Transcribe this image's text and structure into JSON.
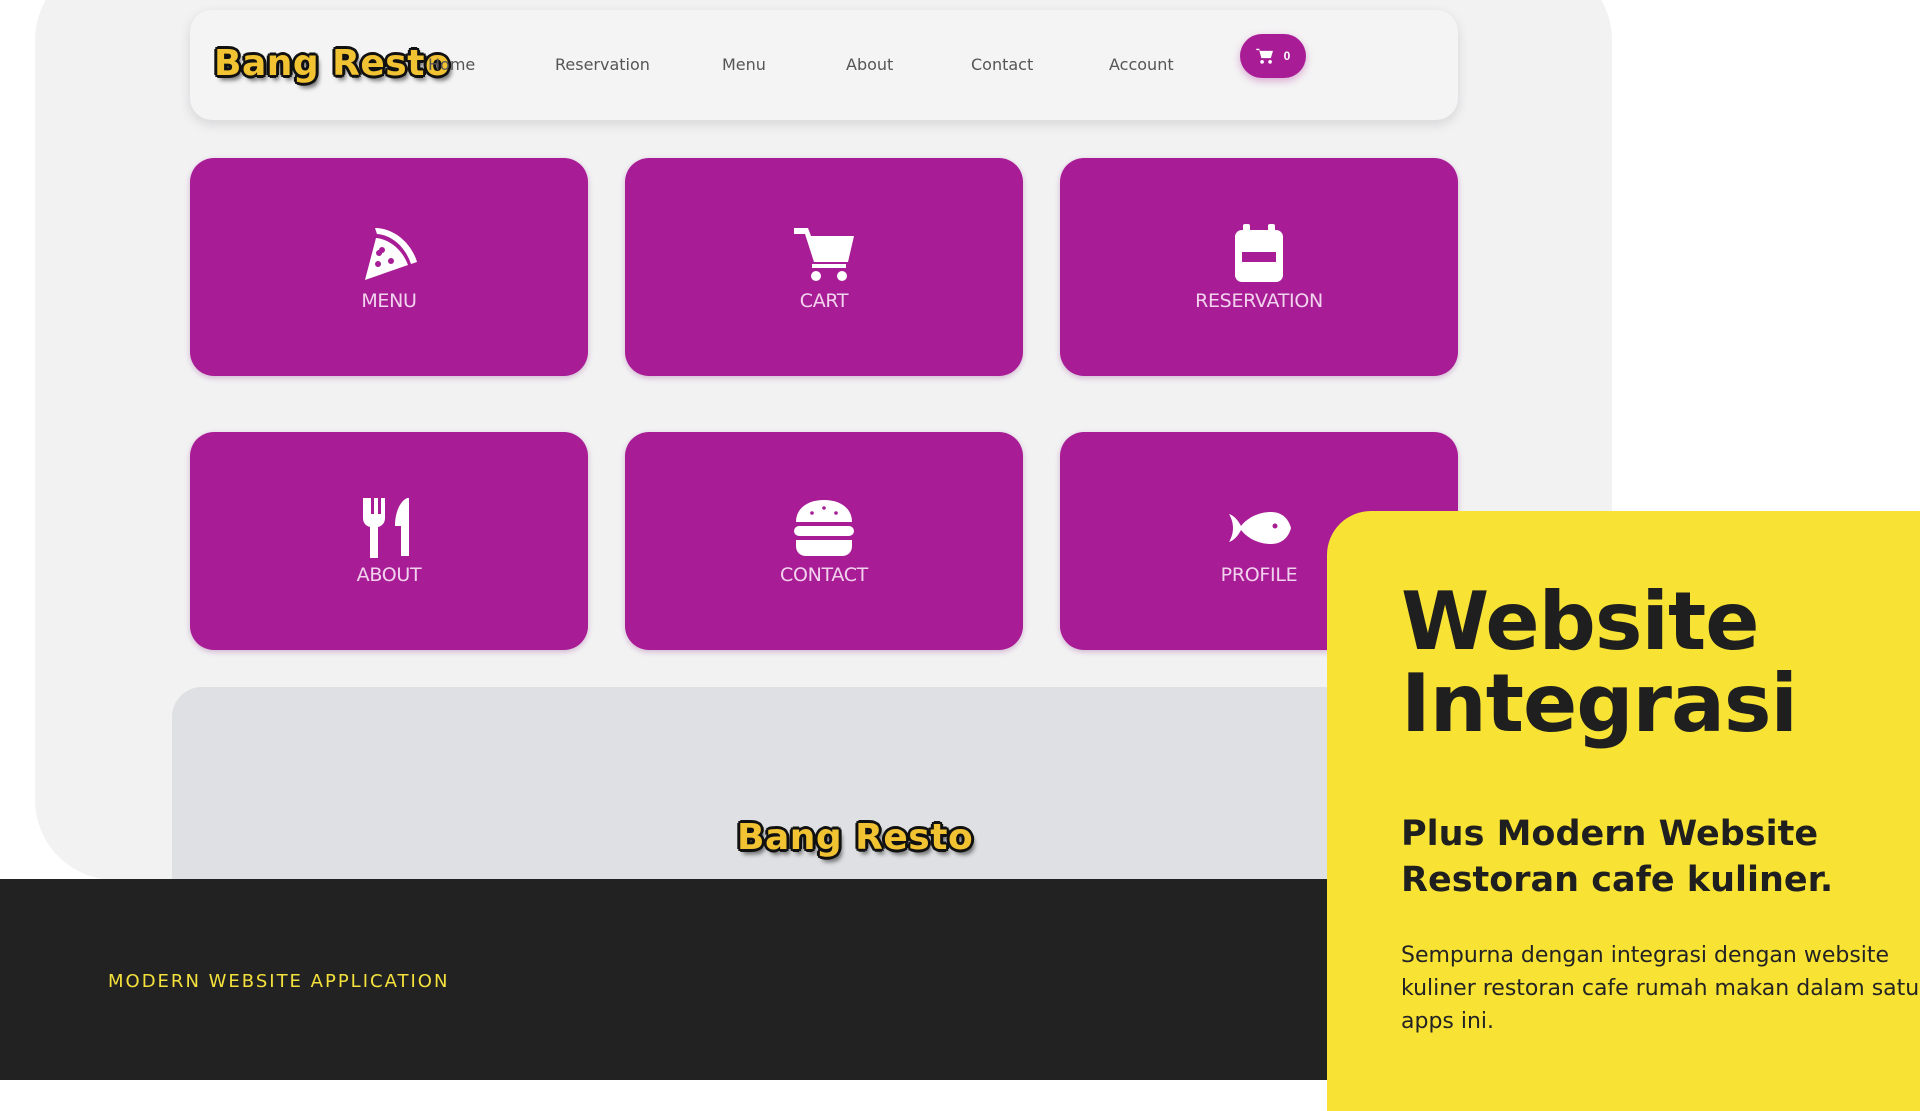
{
  "mockup": {
    "brand": "Bang Resto",
    "nav": {
      "links": [
        "Home",
        "Reservation",
        "Menu",
        "About",
        "Contact",
        "Account"
      ],
      "cart_count": "0"
    },
    "tiles": [
      {
        "label": "MENU",
        "icon": "pizza-icon"
      },
      {
        "label": "CART",
        "icon": "cart-icon"
      },
      {
        "label": "RESERVATION",
        "icon": "calendar-icon"
      },
      {
        "label": "ABOUT",
        "icon": "utensils-icon"
      },
      {
        "label": "CONTACT",
        "icon": "burger-icon"
      },
      {
        "label": "PROFILE",
        "icon": "fish-icon"
      }
    ],
    "footer_brand": "Bang Resto"
  },
  "band": {
    "caption": "MODERN WEBSITE APPLICATION"
  },
  "card": {
    "title_line1": "Website",
    "title_line2": "Integrasi",
    "subtitle": "Plus Modern Website Restoran cafe kuliner.",
    "body": "Sempurna dengan integrasi dengan website kuliner restoran cafe rumah makan dalam satu apps ini."
  },
  "colors": {
    "accent_purple": "#a81d96",
    "accent_yellow": "#f8e334",
    "dark": "#222222",
    "logo_gold": "#f1c232"
  }
}
